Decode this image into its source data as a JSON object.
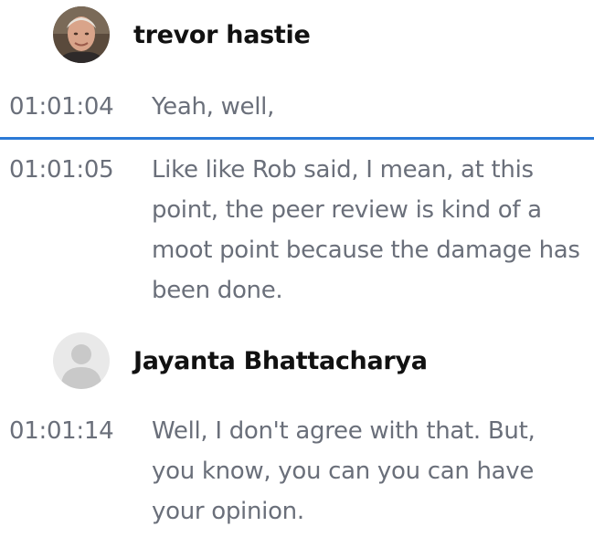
{
  "entries": [
    {
      "speaker": "trevor hastie",
      "avatar_icon": "user-photo-avatar",
      "lines": [
        {
          "time": "01:01:04",
          "text": "Yeah, well,"
        },
        {
          "time": "01:01:05",
          "text": "Like like Rob said, I mean, at this point, the peer review is kind of a moot point because the damage has been done."
        }
      ]
    },
    {
      "speaker": "Jayanta Bhattacharya",
      "avatar_icon": "default-user-avatar-icon",
      "lines": [
        {
          "time": "01:01:14",
          "text": "Well, I don't agree with that. But, you know, you can you can have your opinion."
        }
      ]
    }
  ],
  "colors": {
    "current_line_divider": "#2b79d6",
    "text": "#6a6f7a",
    "speaker": "#111111"
  }
}
